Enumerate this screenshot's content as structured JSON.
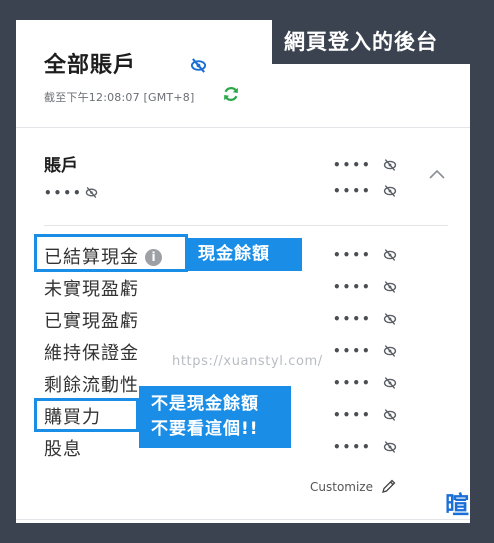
{
  "overlay": {
    "title": "網頁登入的後台"
  },
  "header": {
    "title": "全部賬戶",
    "timestamp": "截至下午12:08:07 [GMT+8]"
  },
  "account": {
    "label": "賬戶",
    "masked_value": "••••",
    "number_masked": "••••"
  },
  "rows": [
    {
      "label": "已結算現金",
      "value": "••••"
    },
    {
      "label": "未實現盈虧",
      "value": "••••"
    },
    {
      "label": "已實現盈虧",
      "value": "••••"
    },
    {
      "label": "維持保證金",
      "value": "••••"
    },
    {
      "label": "剩餘流動性",
      "value": "••••"
    },
    {
      "label": "購買力",
      "value": "••••"
    },
    {
      "label": "股息",
      "value": "••••"
    }
  ],
  "info_icon_glyph": "i",
  "annotations": {
    "cash_tag": "現金餘額",
    "warning_line1": "不是現金餘額",
    "warning_line2": "不要看這個!!"
  },
  "watermark": "https://xuanstyl.com/",
  "footer": {
    "customize_label": "Customize",
    "brand_glyph": "暄"
  },
  "colors": {
    "annotation_blue": "#1a8de6",
    "refresh_green": "#2aa84a",
    "brand_blue": "#1a6fd6",
    "background": "#3b4350"
  }
}
